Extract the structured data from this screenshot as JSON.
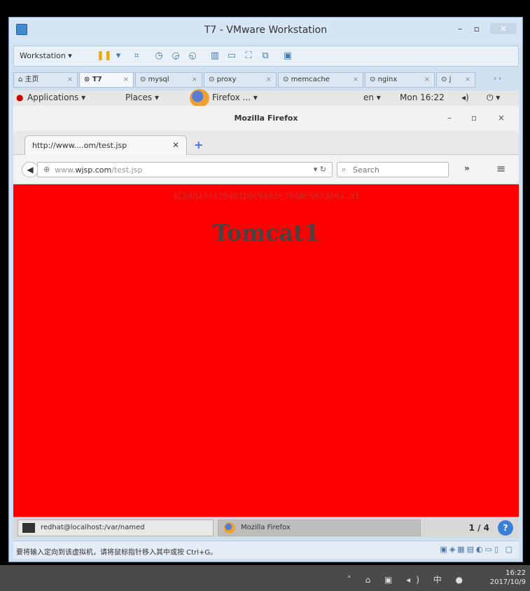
{
  "vmware": {
    "title": "T7 - VMware Workstation",
    "workstation_menu": "Workstation ▾",
    "tabs": [
      {
        "label": "主页",
        "active": false
      },
      {
        "label": "T7",
        "active": true
      },
      {
        "label": "mysql",
        "active": false
      },
      {
        "label": "proxy",
        "active": false
      },
      {
        "label": "memcache",
        "active": false
      },
      {
        "label": "nginx",
        "active": false
      },
      {
        "label": "j",
        "active": false
      }
    ],
    "status_message": "要将输入定向到该虚拟机，请将鼠标指针移入其中或按 Ctrl+G。"
  },
  "gnome": {
    "applications": "Applications ▾",
    "places": "Places ▾",
    "firefox_menu": "Firefox ... ▾",
    "lang": "en ▾",
    "clock": "Mon 16:22",
    "tasks": [
      {
        "label": "redhat@localhost:/var/named"
      },
      {
        "label": "Mozilla Firefox"
      }
    ],
    "workspace": "1 / 4"
  },
  "firefox": {
    "window_title": "Mozilla Firefox",
    "tab_label": "http://www....om/test.jsp",
    "url_host": "www.",
    "url_domain": "wjsp.com",
    "url_path": "/test.jsp",
    "search_placeholder": "Search"
  },
  "page": {
    "session_id": "4C04048412D481D0E9483E7880E5883861.n1",
    "heading": "Tomcat1",
    "background": "#ff0000"
  },
  "host_taskbar": {
    "time": "16:22",
    "date": "2017/10/9"
  }
}
